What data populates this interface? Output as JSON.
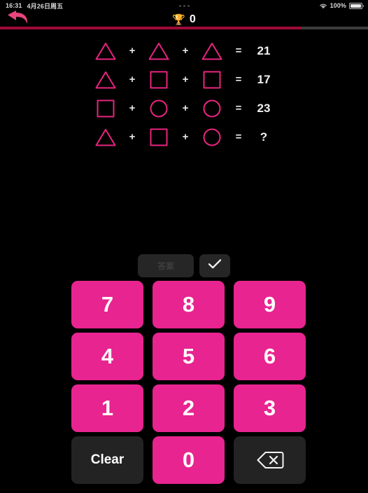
{
  "statusbar": {
    "time": "16:31",
    "date": "4月26日周五",
    "battery_percent": "100%",
    "wifi_icon": "wifi-icon",
    "battery_icon": "battery-icon",
    "multitask_handle": "multitasking-dots"
  },
  "header": {
    "back_icon": "back-arrow-icon",
    "trophy_icon": "🏆",
    "score": "0"
  },
  "progress": {
    "percent": 82,
    "fill_color": "#9e0b38",
    "track_color": "#3c3c3c"
  },
  "theme": {
    "accent": "#e82490",
    "shape_stroke": "#e8257f",
    "background": "#000000",
    "dark_key": "#232323"
  },
  "puzzle": {
    "rows": [
      {
        "shapes": [
          "triangle",
          "triangle",
          "triangle"
        ],
        "operators": [
          "+",
          "+"
        ],
        "equals": "=",
        "result": "21"
      },
      {
        "shapes": [
          "triangle",
          "square",
          "square"
        ],
        "operators": [
          "+",
          "+"
        ],
        "equals": "=",
        "result": "17"
      },
      {
        "shapes": [
          "square",
          "circle",
          "circle"
        ],
        "operators": [
          "+",
          "+"
        ],
        "equals": "=",
        "result": "23"
      },
      {
        "shapes": [
          "triangle",
          "square",
          "circle"
        ],
        "operators": [
          "+",
          "+"
        ],
        "equals": "=",
        "result": "?"
      }
    ]
  },
  "actions": {
    "answer_label": "答案",
    "check_icon": "checkmark-icon"
  },
  "keypad": {
    "keys": [
      {
        "label": "7",
        "style": "num",
        "name": "key-7"
      },
      {
        "label": "8",
        "style": "num",
        "name": "key-8"
      },
      {
        "label": "9",
        "style": "num",
        "name": "key-9"
      },
      {
        "label": "4",
        "style": "num",
        "name": "key-4"
      },
      {
        "label": "5",
        "style": "num",
        "name": "key-5"
      },
      {
        "label": "6",
        "style": "num",
        "name": "key-6"
      },
      {
        "label": "1",
        "style": "num",
        "name": "key-1"
      },
      {
        "label": "2",
        "style": "num",
        "name": "key-2"
      },
      {
        "label": "3",
        "style": "num",
        "name": "key-3"
      },
      {
        "label": "Clear",
        "style": "dark",
        "name": "key-clear"
      },
      {
        "label": "0",
        "style": "num",
        "name": "key-0"
      },
      {
        "label": "backspace-icon",
        "style": "backspace",
        "name": "key-backspace"
      }
    ]
  }
}
